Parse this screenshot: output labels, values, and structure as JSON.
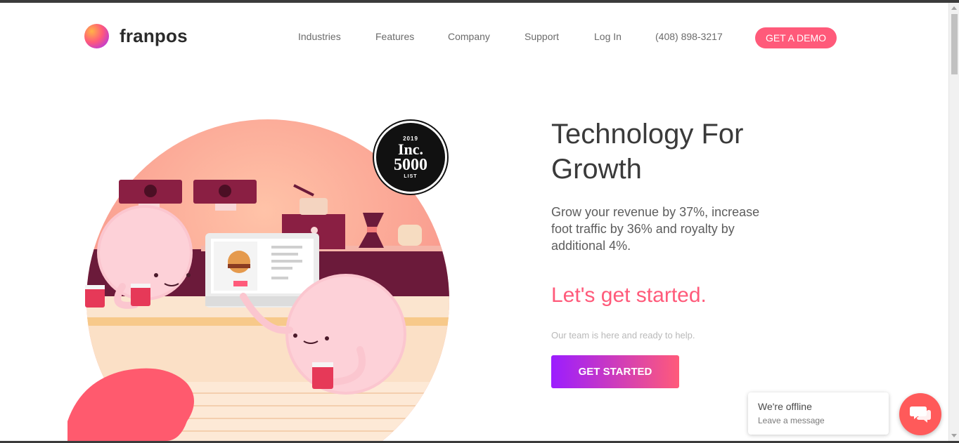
{
  "brand": {
    "name": "franpos"
  },
  "nav": {
    "items": [
      {
        "label": "Industries"
      },
      {
        "label": "Features"
      },
      {
        "label": "Company"
      },
      {
        "label": "Support"
      },
      {
        "label": "Log In"
      },
      {
        "label": "(408) 898-3217"
      }
    ],
    "demo_label": "GET A DEMO"
  },
  "badge": {
    "year": "2019",
    "line1": "Inc.",
    "line2": "5000",
    "line3": "LIST"
  },
  "hero": {
    "title": "Technology For Growth",
    "subtitle": "Grow your revenue by 37%, increase foot traffic by 36% and royalty by additional 4%.",
    "cta_heading": "Let's get started.",
    "cta_note": "Our team is here and ready to help.",
    "cta_button": "GET STARTED"
  },
  "chat": {
    "status": "We're offline",
    "message": "Leave a message"
  },
  "colors": {
    "accent": "#ff5a7a",
    "gradient_start": "#9b1dff",
    "chat": "#ff5a5a"
  }
}
